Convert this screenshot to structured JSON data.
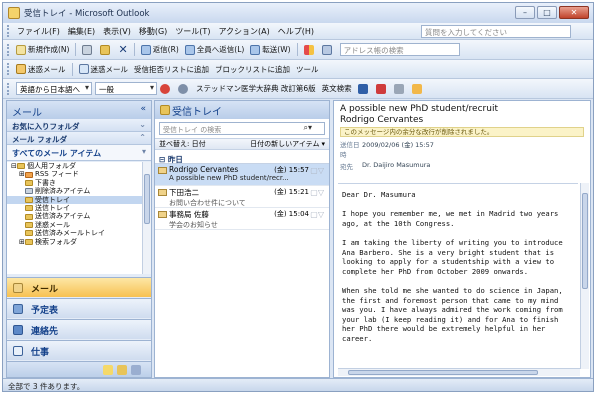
{
  "window": {
    "title": "受信トレイ - Microsoft Outlook",
    "min": "–",
    "max": "□",
    "close": "✕"
  },
  "menu": [
    "ファイル(F)",
    "編集(E)",
    "表示(V)",
    "移動(G)",
    "ツール(T)",
    "アクション(A)",
    "ヘルプ(H)"
  ],
  "help_placeholder": "質問を入力してください",
  "toolbar1": {
    "new": "新規作成(N)",
    "reply": "返信(R)",
    "reply_all": "全員へ返信(L)",
    "forward": "転送(W)",
    "address_book_placeholder": "アドレス帳の検索"
  },
  "toolbar2": {
    "junk": "迷惑メール",
    "junk_senders": "迷惑メール",
    "safe_senders": "受信拒否リストに追加",
    "blocked": "ブロックリストに追加",
    "tools": "ツール"
  },
  "toolbar3": {
    "translate": "英語から日本語へ",
    "mode": "一般",
    "dictionary": "ステッドマン医学大辞典 改訂第6版",
    "bilingual": "英文検索"
  },
  "nav": {
    "header": "メール",
    "favorites": "お気に入りフォルダ",
    "mail_folders": "メール フォルダ",
    "all_mail": "すべてのメール アイテム",
    "folders": [
      "個人用フォルダ",
      "RSS フィード",
      "下書き",
      "削除済みアイテム",
      "受信トレイ",
      "送信トレイ",
      "送信済みアイテム",
      "迷惑メール",
      "送信済みメールトレイ",
      "検索フォルダ"
    ],
    "buttons": [
      "メール",
      "予定表",
      "連絡先",
      "仕事"
    ]
  },
  "list": {
    "header": "受信トレイ",
    "search_placeholder": "受信トレイ の検索",
    "sort_label": "並べ替え: 日付",
    "sort_order": "日付の新しいアイテム",
    "group": "昨日",
    "messages": [
      {
        "from": "Rodrigo Cervantes",
        "date": "(金) 15:57",
        "subject": "A possible new PhD student/recr..."
      },
      {
        "from": "下田浩二",
        "date": "(金) 15:21",
        "subject": "お問い合わせ件について"
      },
      {
        "from": "事務局 佐藤",
        "date": "(金) 15:04",
        "subject": "学会のお知らせ"
      }
    ]
  },
  "reader": {
    "subject": "A possible new PhD student/recruit",
    "from": "Rodrigo Cervantes",
    "info": "このメッセージ内の余分な改行が削除されました。",
    "sent_label": "送信日時",
    "sent": "2009/02/06 (金) 15:57",
    "to_label": "宛先",
    "to": "Dr. Daijiro Masumura",
    "body": [
      "Dear Dr. Masumura",
      "I hope you remember me, we met in Madrid two years ago, at the 10th Congress.",
      "I am taking the liberty of writing you to introduce Ana Barbero. She is a very bright student that is looking to apply for a studentship with a view to complete her PhD from October 2009 onwards.",
      "When she told me she wanted to do science in Japan, the first and foremost person that came to my mind was you. I have always admired the work coming from your lab (I keep reading it) and for Ana to finish her PhD there would be extremely helpful in her career."
    ]
  },
  "status": "全部で 3 件あります。"
}
